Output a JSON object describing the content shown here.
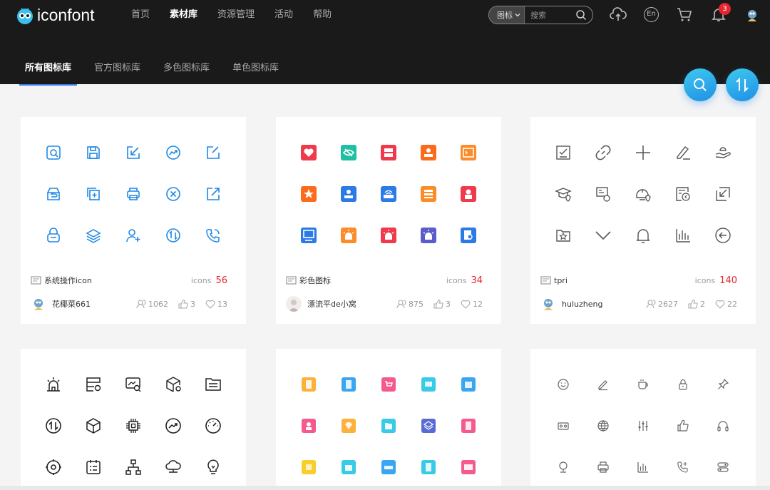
{
  "logo": {
    "text": "iconfont"
  },
  "nav": {
    "items": [
      "首页",
      "素材库",
      "资源管理",
      "活动",
      "帮助"
    ],
    "active": 1
  },
  "search": {
    "type_label": "图标",
    "placeholder": "搜索"
  },
  "header_icons": {
    "upload": "cloud-upload-icon",
    "lang": "En",
    "cart": "cart-icon",
    "bell": "bell-icon",
    "notification_count": "3"
  },
  "tabs": [
    "所有图标库",
    "官方图标库",
    "多色图标库",
    "单色图标库"
  ],
  "colors": {
    "accent": "#3a7bf0",
    "red": "#e8242c",
    "blue_icon": "#1e88e5",
    "header_bg": "#1a1a1a"
  },
  "cards": [
    {
      "name": "系统操作icon",
      "icons_label": "icons",
      "count": "56",
      "owner": "花椰菜661",
      "followers": "1062",
      "likes": "3",
      "favorites": "13",
      "style": "blue"
    },
    {
      "name": "彩色图标",
      "icons_label": "icons",
      "count": "34",
      "owner": "漂流平de小窝",
      "followers": "875",
      "likes": "3",
      "favorites": "12",
      "style": "color"
    },
    {
      "name": "tpri",
      "icons_label": "icons",
      "count": "140",
      "owner": "huluzheng",
      "followers": "2627",
      "likes": "2",
      "favorites": "22",
      "style": "gray"
    },
    {
      "style": "dark"
    },
    {
      "style": "pastel"
    },
    {
      "style": "gray-small"
    }
  ]
}
